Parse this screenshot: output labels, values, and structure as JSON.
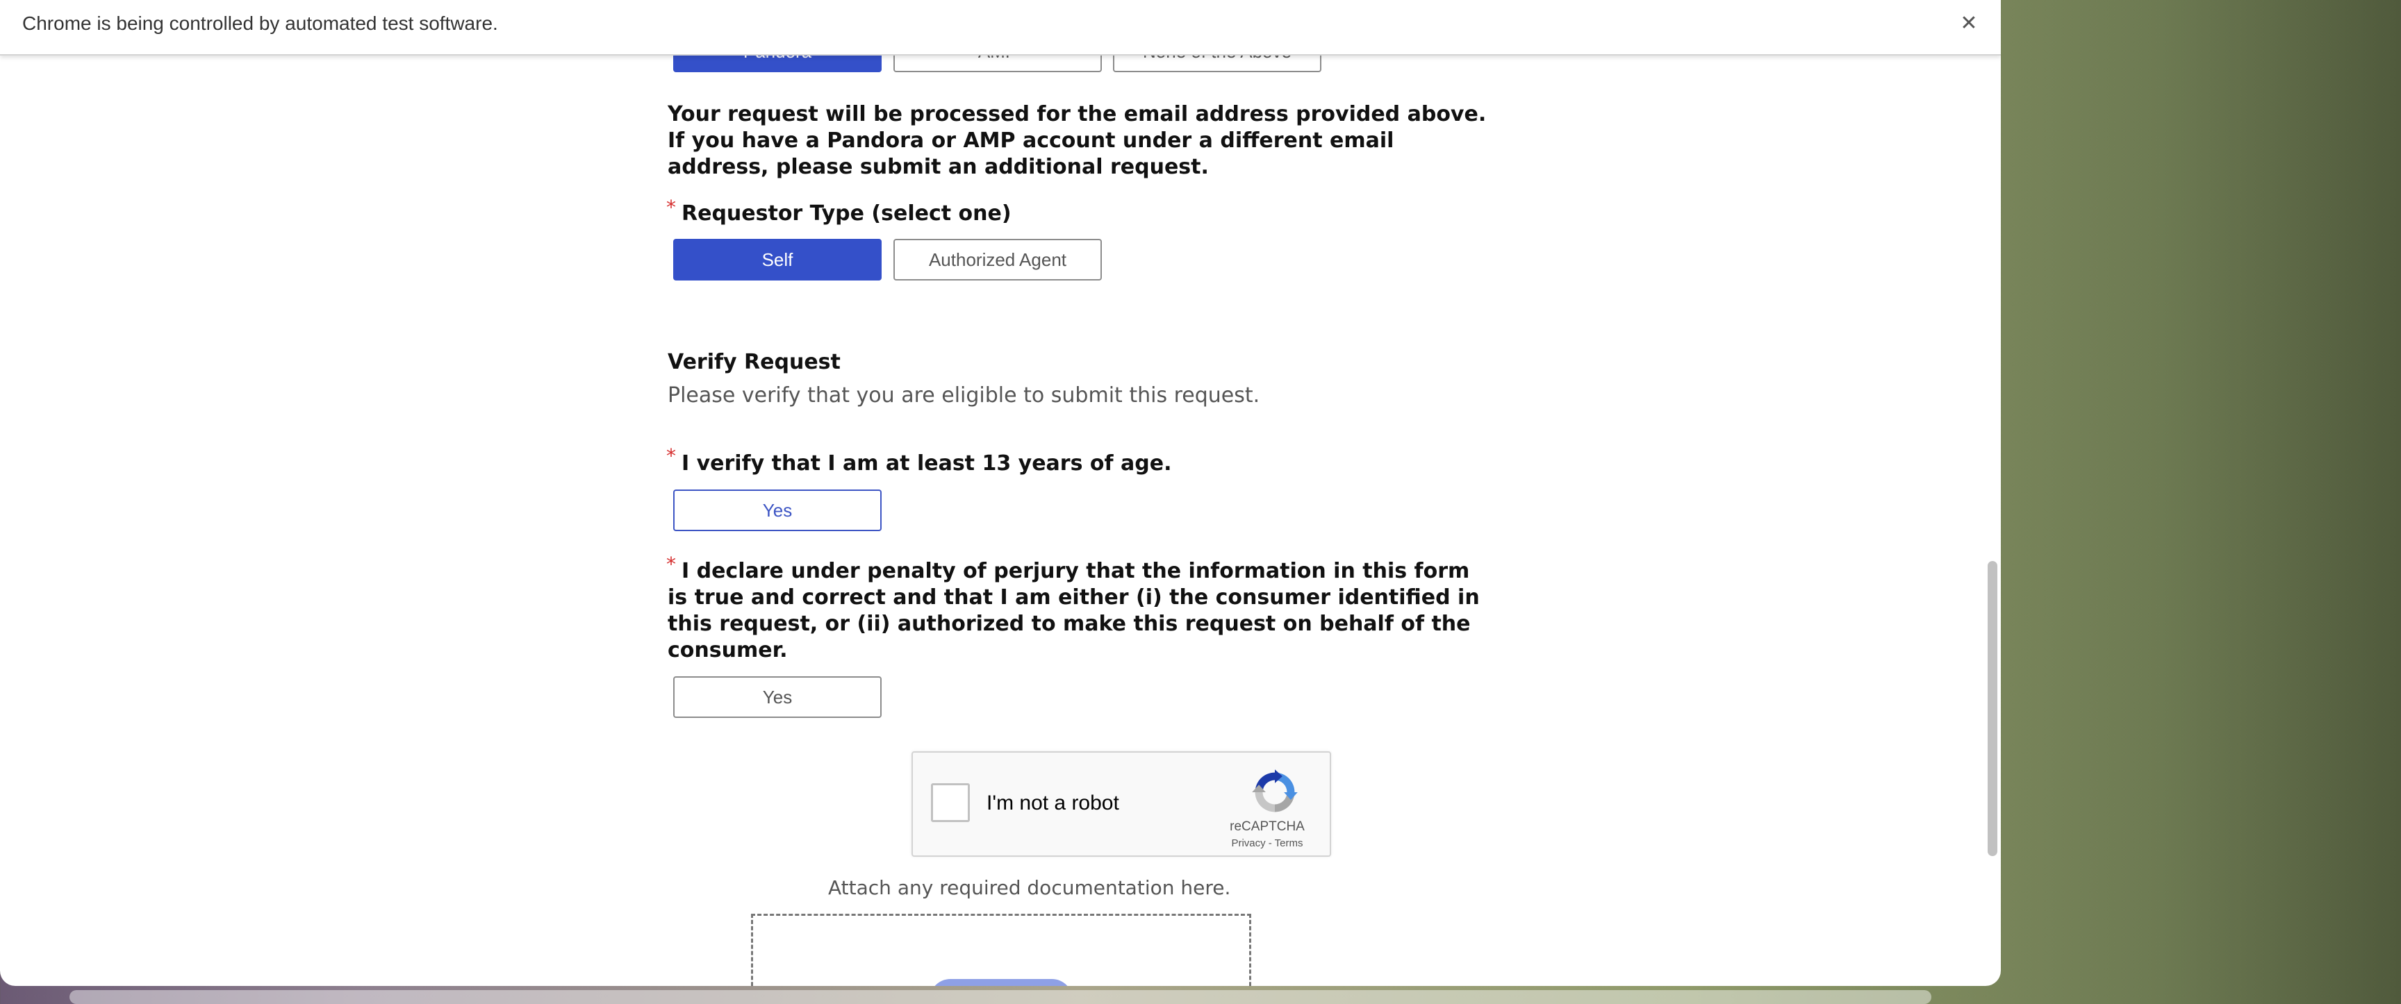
{
  "infobar": {
    "message": "Chrome is being controlled by automated test software.",
    "close_symbol": "✕"
  },
  "brand_options": [
    "Pandora",
    "AMP",
    "None of the Above"
  ],
  "notice": {
    "line1": "Your request will be processed for the email address provided above.",
    "line2": "If you have a Pandora or AMP account under a different email",
    "line3": "address, please submit an additional request."
  },
  "requestor": {
    "required_mark": "*",
    "label": "Requestor Type (select one)",
    "options": [
      "Self",
      "Authorized Agent"
    ],
    "selected": "Self"
  },
  "verify": {
    "title": "Verify Request",
    "subtitle": "Please verify that you are eligible to submit this request.",
    "age_required_mark": "*",
    "age_question": "I verify that I am at least 13 years of age.",
    "age_yes": "Yes",
    "perjury_required_mark": "*",
    "perjury_line1": "I declare under penalty of perjury that the information in this form",
    "perjury_line2": "is true and correct and that I am either (i) the consumer identified in",
    "perjury_line3": "this request, or (ii) authorized to make this request on behalf of the",
    "perjury_line4": "consumer.",
    "perjury_yes": "Yes"
  },
  "recaptcha": {
    "label": "I'm not a robot",
    "brand": "reCAPTCHA",
    "links": "Privacy - Terms",
    "logo_icon": "recaptcha-logo-icon"
  },
  "attachments": {
    "label": "Attach any required documentation here."
  },
  "colors": {
    "selected_button": "#3450c9",
    "required_star": "#d62f2f",
    "outline_blue": "#3d55c4"
  }
}
